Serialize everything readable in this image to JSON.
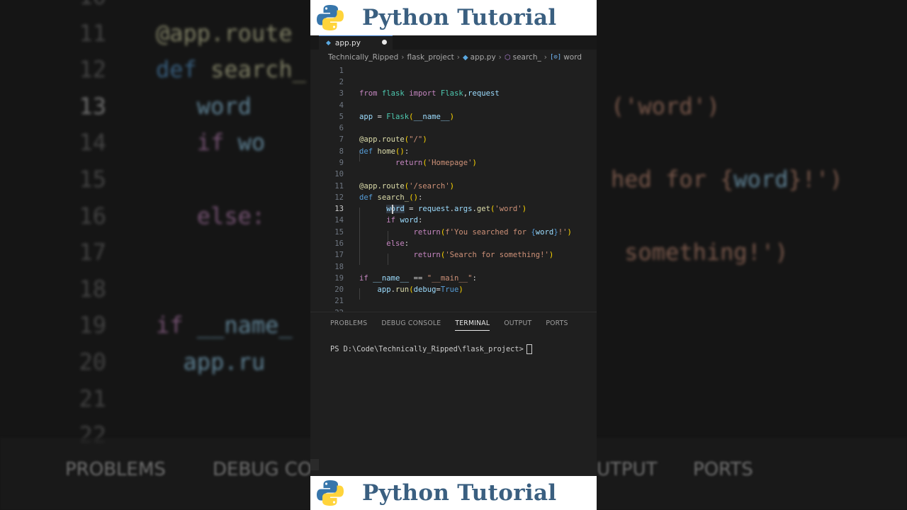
{
  "banner": {
    "title": "Python Tutorial"
  },
  "tab": {
    "label": "app.py"
  },
  "breadcrumb": {
    "items": [
      "Technically_Ripped",
      "flask_project",
      "app.py",
      "search_",
      "word"
    ]
  },
  "editor": {
    "line_numbers": [
      "1",
      "2",
      "3",
      "4",
      "5",
      "6",
      "7",
      "8",
      "9",
      "10",
      "11",
      "12",
      "13",
      "14",
      "15",
      "16",
      "17",
      "18",
      "19",
      "20",
      "21",
      "22"
    ],
    "active_line": "13"
  },
  "panel": {
    "tabs": [
      "PROBLEMS",
      "DEBUG CONSOLE",
      "TERMINAL",
      "OUTPUT",
      "PORTS"
    ],
    "active_tab": "TERMINAL"
  },
  "terminal": {
    "prompt": "PS D:\\Code\\Technically_Ripped\\flask_project>"
  },
  "colors": {
    "banner_title": "#3a5f80",
    "editor_bg": "#1f1f1f",
    "keyword": "#c586c0",
    "function": "#dcdcaa",
    "string": "#ce9178",
    "variable": "#9cdcfe"
  }
}
